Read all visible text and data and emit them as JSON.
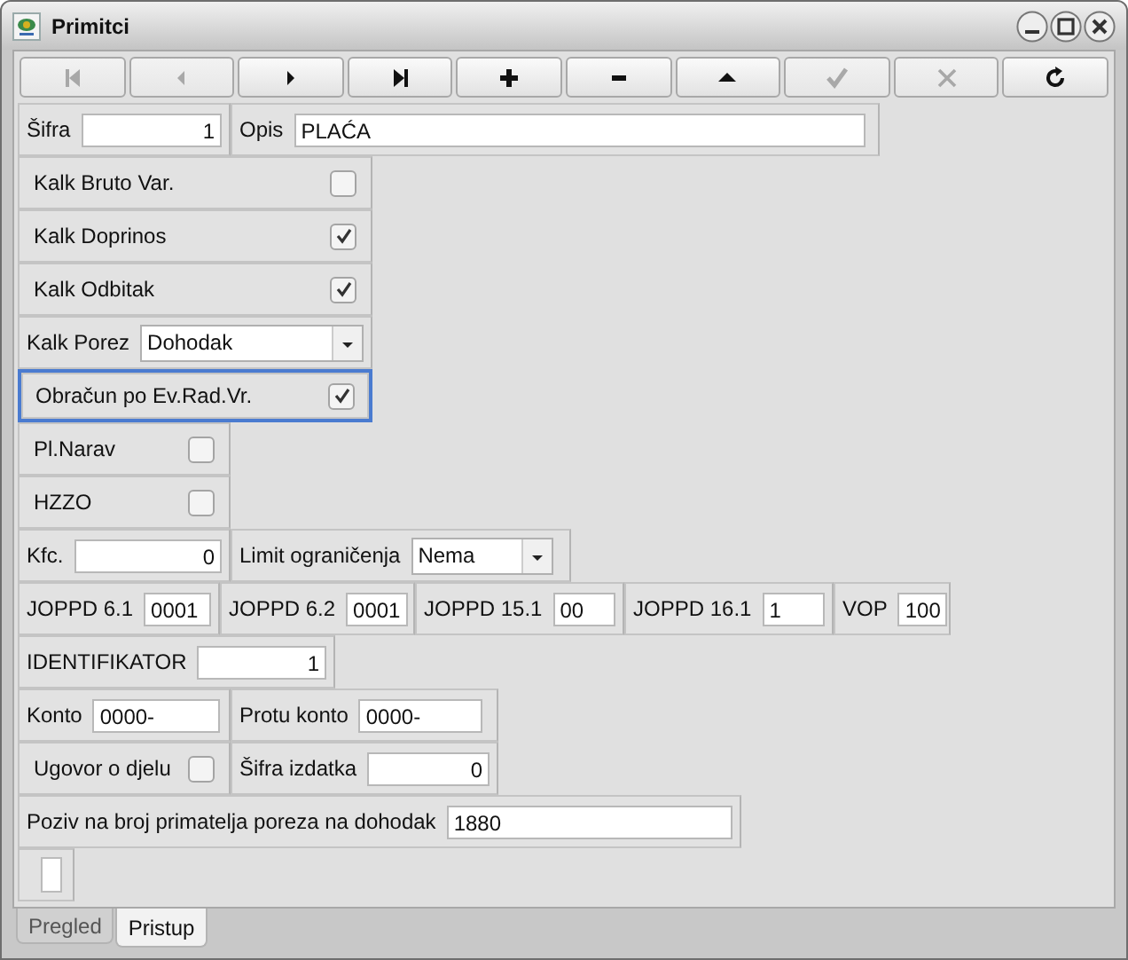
{
  "window": {
    "title": "Primitci"
  },
  "toolbar": [
    {
      "kind": "first",
      "disabled": true
    },
    {
      "kind": "prev",
      "disabled": true
    },
    {
      "kind": "next",
      "disabled": false
    },
    {
      "kind": "last",
      "disabled": false
    },
    {
      "kind": "add",
      "disabled": false
    },
    {
      "kind": "remove",
      "disabled": false
    },
    {
      "kind": "up",
      "disabled": false
    },
    {
      "kind": "confirm",
      "disabled": true
    },
    {
      "kind": "cancel",
      "disabled": true
    },
    {
      "kind": "refresh",
      "disabled": false
    }
  ],
  "rows": [
    [
      {
        "kind": "number",
        "label": "Šifra",
        "value": "1"
      },
      {
        "kind": "field",
        "label": "Opis",
        "value": "PLAĆA"
      }
    ],
    [
      {
        "kind": "checkbox",
        "label": "Kalk Bruto Var.",
        "checked": false,
        "focused": false
      }
    ],
    [
      {
        "kind": "checkbox",
        "label": "Kalk Doprinos",
        "checked": true,
        "focused": false
      }
    ],
    [
      {
        "kind": "checkbox",
        "label": "Kalk Odbitak",
        "checked": true,
        "focused": false
      }
    ],
    [
      {
        "kind": "dropdown",
        "label": "Kalk Porez",
        "value": "Dohodak"
      }
    ],
    [
      {
        "kind": "checkbox",
        "label": "Obračun po Ev.Rad.Vr.",
        "checked": true,
        "focused": true
      }
    ],
    [
      {
        "kind": "checkbox",
        "label": "Pl.Narav",
        "checked": false,
        "focused": false
      }
    ],
    [
      {
        "kind": "checkbox",
        "label": "HZZO",
        "checked": false,
        "focused": false
      }
    ],
    [
      {
        "kind": "number",
        "label": "Kfc.",
        "value": "0"
      },
      {
        "kind": "dropdown",
        "label": "Limit ograničenja",
        "value": "Nema"
      }
    ],
    [
      {
        "kind": "field",
        "label": "JOPPD 6.1",
        "value": "0001"
      },
      {
        "kind": "field",
        "label": "JOPPD 6.2",
        "value": "0001"
      },
      {
        "kind": "field",
        "label": "JOPPD 15.1",
        "value": "00"
      },
      {
        "kind": "field",
        "label": "JOPPD 16.1",
        "value": "1"
      },
      {
        "kind": "field",
        "label": "VOP",
        "value": "100"
      }
    ],
    [
      {
        "kind": "number",
        "label": "IDENTIFIKATOR",
        "value": "1"
      }
    ],
    [
      {
        "kind": "field",
        "label": "Konto",
        "value": "0000-"
      },
      {
        "kind": "field",
        "label": "Protu konto",
        "value": "0000-"
      }
    ],
    [
      {
        "kind": "checkbox",
        "label": "Ugovor o djelu",
        "checked": false,
        "focused": false
      },
      {
        "kind": "number",
        "label": "Šifra izdatka",
        "value": "0"
      }
    ],
    [
      {
        "kind": "field",
        "label": "Poziv na broj primatelja poreza na dohodak",
        "value": "1880"
      }
    ],
    [
      {
        "kind": "empty"
      }
    ]
  ],
  "tabs": [
    {
      "label": "Pregled",
      "selected": false
    },
    {
      "label": "Pristup",
      "selected": true
    }
  ]
}
